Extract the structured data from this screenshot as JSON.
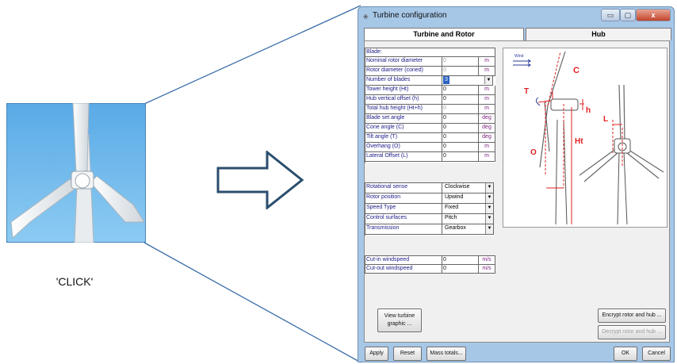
{
  "caption": "'CLICK'",
  "window": {
    "title": "Turbine configuration",
    "controls": {
      "minimize": "▭",
      "maximize": "▢",
      "close": "x"
    }
  },
  "tabs": [
    "Turbine and Rotor",
    "Hub"
  ],
  "blade_section": {
    "header": "Blade:",
    "rows": [
      {
        "label": "Nominal rotor diameter",
        "value": "0",
        "unit": "m",
        "dim": true
      },
      {
        "label": "Rotor diameter (coned)",
        "value": "0",
        "unit": "m",
        "dim": true
      },
      {
        "label": "Number of blades",
        "value": "3",
        "select": true
      },
      {
        "label": "Tower height (Ht)",
        "value": "0",
        "unit": "m"
      },
      {
        "label": "Hub vertical offset (h)",
        "value": "0",
        "unit": "m"
      },
      {
        "label": "Total hub height (Ht+h)",
        "value": "0",
        "unit": "m",
        "dim": true
      },
      {
        "label": "Blade set angle",
        "value": "0",
        "unit": "deg"
      },
      {
        "label": "Cone angle (C)",
        "value": "0",
        "unit": "deg"
      },
      {
        "label": "Tilt angle (T)",
        "value": "0",
        "unit": "deg"
      },
      {
        "label": "Overhang (O)",
        "value": "0",
        "unit": "m"
      },
      {
        "label": "Lateral Offset (L)",
        "value": "0",
        "unit": "m"
      }
    ]
  },
  "settings": [
    {
      "label": "Rotational sense",
      "value": "Clockwise"
    },
    {
      "label": "Rotor position",
      "value": "Upwind"
    },
    {
      "label": "Speed Type",
      "value": "Fixed"
    },
    {
      "label": "Control surfaces",
      "value": "Pitch"
    },
    {
      "label": "Transmission",
      "value": "Gearbox"
    }
  ],
  "windspeeds": [
    {
      "label": "Cut-in windspeed",
      "value": "0",
      "unit": "m/s"
    },
    {
      "label": "Cut-out windspeed",
      "value": "0",
      "unit": "m/s"
    }
  ],
  "diagram_labels": {
    "wind": "Wind",
    "C": "C",
    "T": "T",
    "h": "h",
    "L": "L",
    "O": "O",
    "Ht": "Ht"
  },
  "buttons": {
    "view_graphic": "View turbine graphic ...",
    "encrypt": "Encrypt rotor and hub ...",
    "decrypt": "Decrypt rotor and hub ...",
    "apply": "Apply",
    "reset": "Reset",
    "mass_totals": "Mass totals...",
    "ok": "OK",
    "cancel": "Cancel"
  },
  "colors": {
    "accent_red": "#e02020",
    "window_frame": "#a7c7e7",
    "icon_sky": "#6fb6ea",
    "selection": "#2b63c2"
  }
}
